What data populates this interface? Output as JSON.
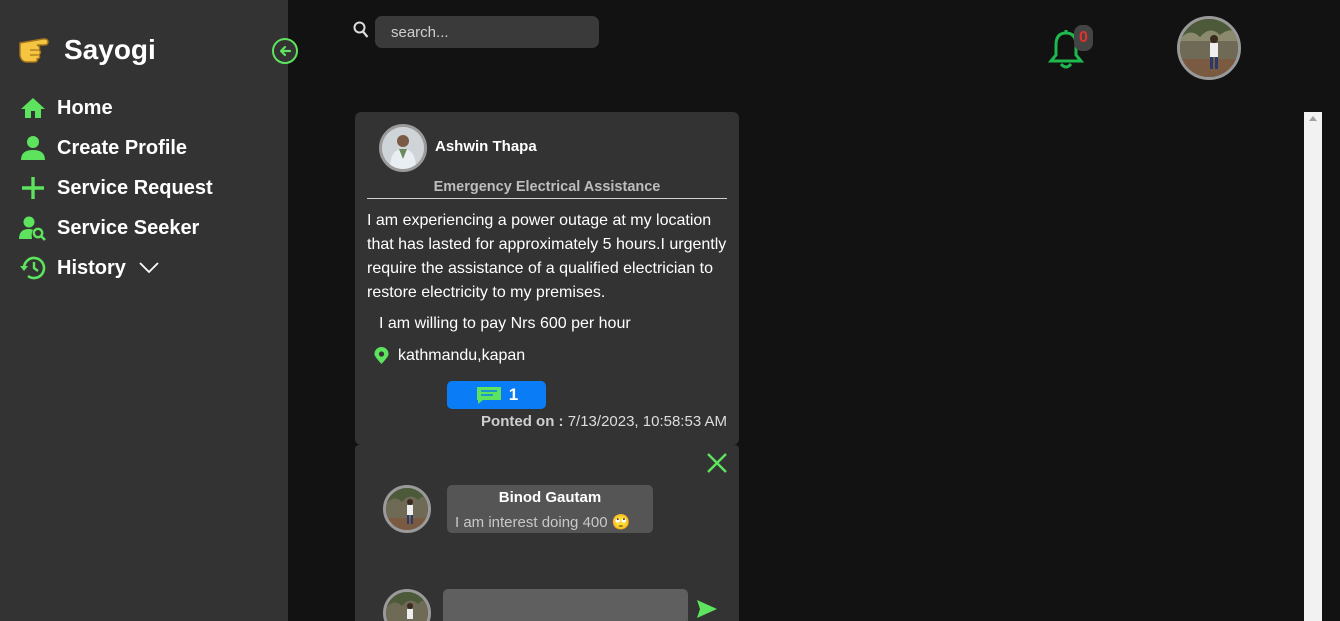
{
  "sidebar": {
    "brand": "Sayogi",
    "items": [
      {
        "label": "Home",
        "icon": "home-icon"
      },
      {
        "label": "Create Profile",
        "icon": "person-icon"
      },
      {
        "label": "Service Request",
        "icon": "plus-icon"
      },
      {
        "label": "Service Seeker",
        "icon": "person-search-icon"
      },
      {
        "label": "History",
        "icon": "history-icon"
      }
    ]
  },
  "header": {
    "search_placeholder": "search...",
    "notification_count": "0"
  },
  "post": {
    "author": "Ashwin Thapa",
    "title": "Emergency Electrical Assistance",
    "body": "I am experiencing a power outage at my location that has lasted for approximately 5 hours.I urgently require the assistance of a qualified electrician to restore electricity to my premises.",
    "pay": "I am willing to pay Nrs 600 per hour",
    "location": "kathmandu,kapan",
    "comment_count": "1",
    "posted_label": "Ponted on :",
    "posted_date": "7/13/2023, 10:58:53 AM"
  },
  "comments": [
    {
      "author": "Binod Gautam",
      "text": "I am interest doing 400 🙄"
    }
  ],
  "colors": {
    "accent": "#5de35d",
    "bell": "#1fb84e",
    "sidebar_bg": "#333333",
    "page_bg": "#121212",
    "comment_button": "#0a7cf5"
  }
}
